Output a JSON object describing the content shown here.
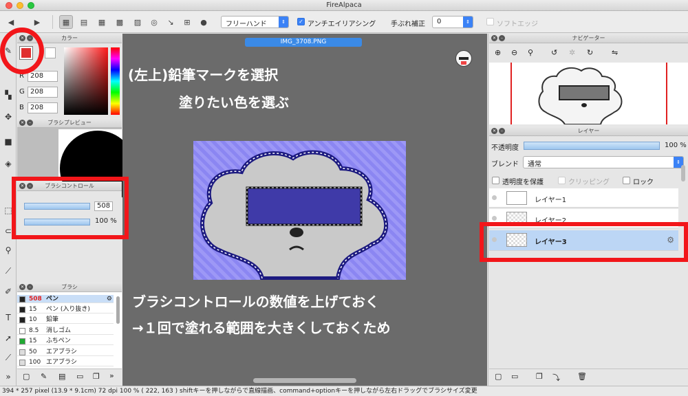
{
  "window": {
    "title": "FireAlpaca"
  },
  "toolbar": {
    "brush_mode": "フリーハンド",
    "antialias_label": "アンチエイリアシング",
    "stabilizer_label": "手ぶれ補正",
    "stabilizer_value": "0",
    "soft_edge_label": "ソフトエッジ"
  },
  "color_panel": {
    "title": "カラー",
    "r": "208",
    "g": "208",
    "b": "208",
    "r_label": "R",
    "g_label": "G",
    "b_label": "B"
  },
  "brush_preview": {
    "title": "ブラシプレビュー"
  },
  "brush_control": {
    "title": "ブラシコントロール",
    "size": "508",
    "opacity": "100 %"
  },
  "brush_panel": {
    "title": "ブラシ",
    "items": [
      {
        "size": "508",
        "name": "ペン",
        "color": "#222222"
      },
      {
        "size": "15",
        "name": "ペン (入り抜き)",
        "color": "#222222"
      },
      {
        "size": "10",
        "name": "鉛筆",
        "color": "#222222"
      },
      {
        "size": "8.5",
        "name": "消しゴム",
        "color": "#ffffff"
      },
      {
        "size": "15",
        "name": "ふちペン",
        "color": "#1faa32"
      },
      {
        "size": "50",
        "name": "エアブラシ",
        "color": "#dddddd"
      },
      {
        "size": "100",
        "name": "エアブラシ",
        "color": "#dddddd"
      }
    ]
  },
  "canvas": {
    "tab": "IMG_3708.PNG",
    "overlay_line1": "(左上)鉛筆マークを選択",
    "overlay_line2": "塗りたい色を選ぶ",
    "overlay_line3": "ブラシコントロールの数値を上げておく",
    "overlay_line4": "→１回で塗れる範囲を大きくしておくため"
  },
  "navigator": {
    "title": "ナビゲーター"
  },
  "layer_panel": {
    "title": "レイヤー",
    "opacity_label": "不透明度",
    "opacity_value": "100 %",
    "blend_label": "ブレンド",
    "blend_value": "通常",
    "protect_label": "透明度を保護",
    "clipping_label": "クリッピング",
    "lock_label": "ロック",
    "layers": [
      {
        "name": "レイヤー1"
      },
      {
        "name": "レイヤー2"
      },
      {
        "name": "レイヤー3"
      }
    ]
  },
  "statusbar": {
    "text": "394 * 257 pixel   (13.9 * 9.1cm)   72 dpi   100 %   ( 222, 163 )   shiftキーを押しながらで直線描画、command+optionキーを押しながら左右ドラッグでブラシサイズ変更"
  },
  "colors": {
    "accent": "#3b82f6",
    "highlight": "#f2161a",
    "fg_color": "#e03030"
  }
}
